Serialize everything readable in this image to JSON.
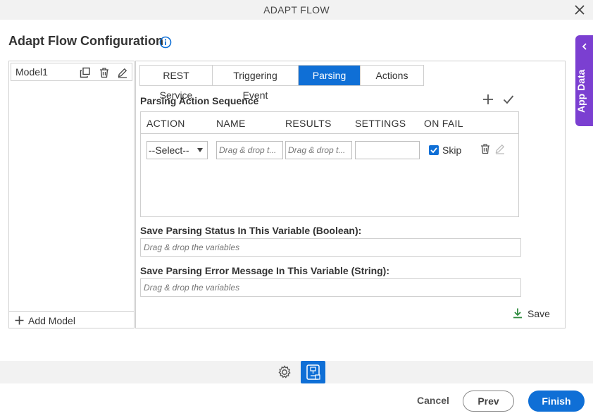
{
  "window": {
    "title": "ADAPT FLOW",
    "close_icon": "close-icon"
  },
  "page": {
    "heading": "Adapt Flow Configuration",
    "info_icon": "info-icon"
  },
  "app_data_tab": {
    "label": "App Data",
    "icon": "chevron-left-icon",
    "color": "#7b3fd1"
  },
  "models": {
    "items": [
      {
        "name": "Model1",
        "icons": [
          "copy-icon",
          "trash-icon",
          "edit-icon"
        ]
      }
    ],
    "add_label": "Add Model"
  },
  "tabs": [
    {
      "label": "REST Service",
      "active": false
    },
    {
      "label": "Triggering Event",
      "active": false
    },
    {
      "label": "Parsing",
      "active": true
    },
    {
      "label": "Actions",
      "active": false
    }
  ],
  "parsing": {
    "section_title": "Parsing Action Sequence",
    "columns": [
      "ACTION",
      "NAME",
      "RESULTS",
      "SETTINGS",
      "ON FAIL"
    ],
    "row": {
      "action_value": "--Select--",
      "name_placeholder": "Drag & drop t...",
      "results_placeholder": "Drag & drop t...",
      "settings_value": "",
      "on_fail_checked": true,
      "on_fail_label": "Skip"
    },
    "status_label": "Save Parsing Status In This Variable (Boolean):",
    "status_placeholder": "Drag & drop the variables",
    "error_label": "Save Parsing Error Message In This Variable (String):",
    "error_placeholder": "Drag & drop the variables",
    "save_label": "Save"
  },
  "footer": {
    "cancel_label": "Cancel",
    "prev_label": "Prev",
    "finish_label": "Finish"
  },
  "colors": {
    "accent": "#0f6fd6",
    "save_icon": "#2e8b3e"
  }
}
